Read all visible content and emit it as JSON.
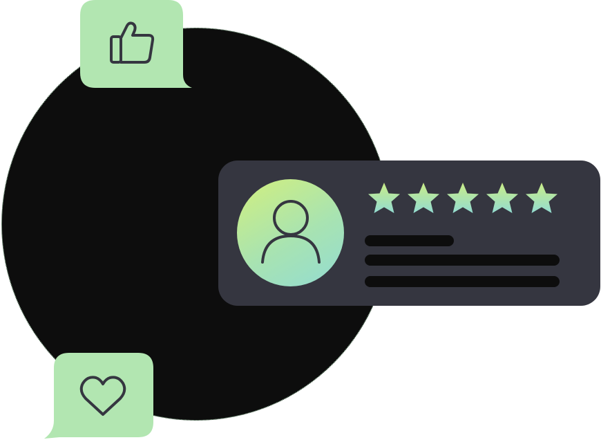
{
  "illustration": {
    "rating": {
      "value": 5,
      "max": 5
    },
    "stars": [
      {
        "icon": "star-icon"
      },
      {
        "icon": "star-icon"
      },
      {
        "icon": "star-icon"
      },
      {
        "icon": "star-icon"
      },
      {
        "icon": "star-icon"
      }
    ],
    "icons": {
      "like": "thumbs-up-icon",
      "love": "heart-icon",
      "user": "user-icon"
    },
    "colors": {
      "backdrop": "#0d0d0d",
      "bubble": "#b2e6b1",
      "card": "#353640",
      "icon_stroke": "#353640",
      "placeholder_bar": "#0d0d0d",
      "gradient_start": "#d2ef7e",
      "gradient_end": "#93dcd2"
    }
  }
}
